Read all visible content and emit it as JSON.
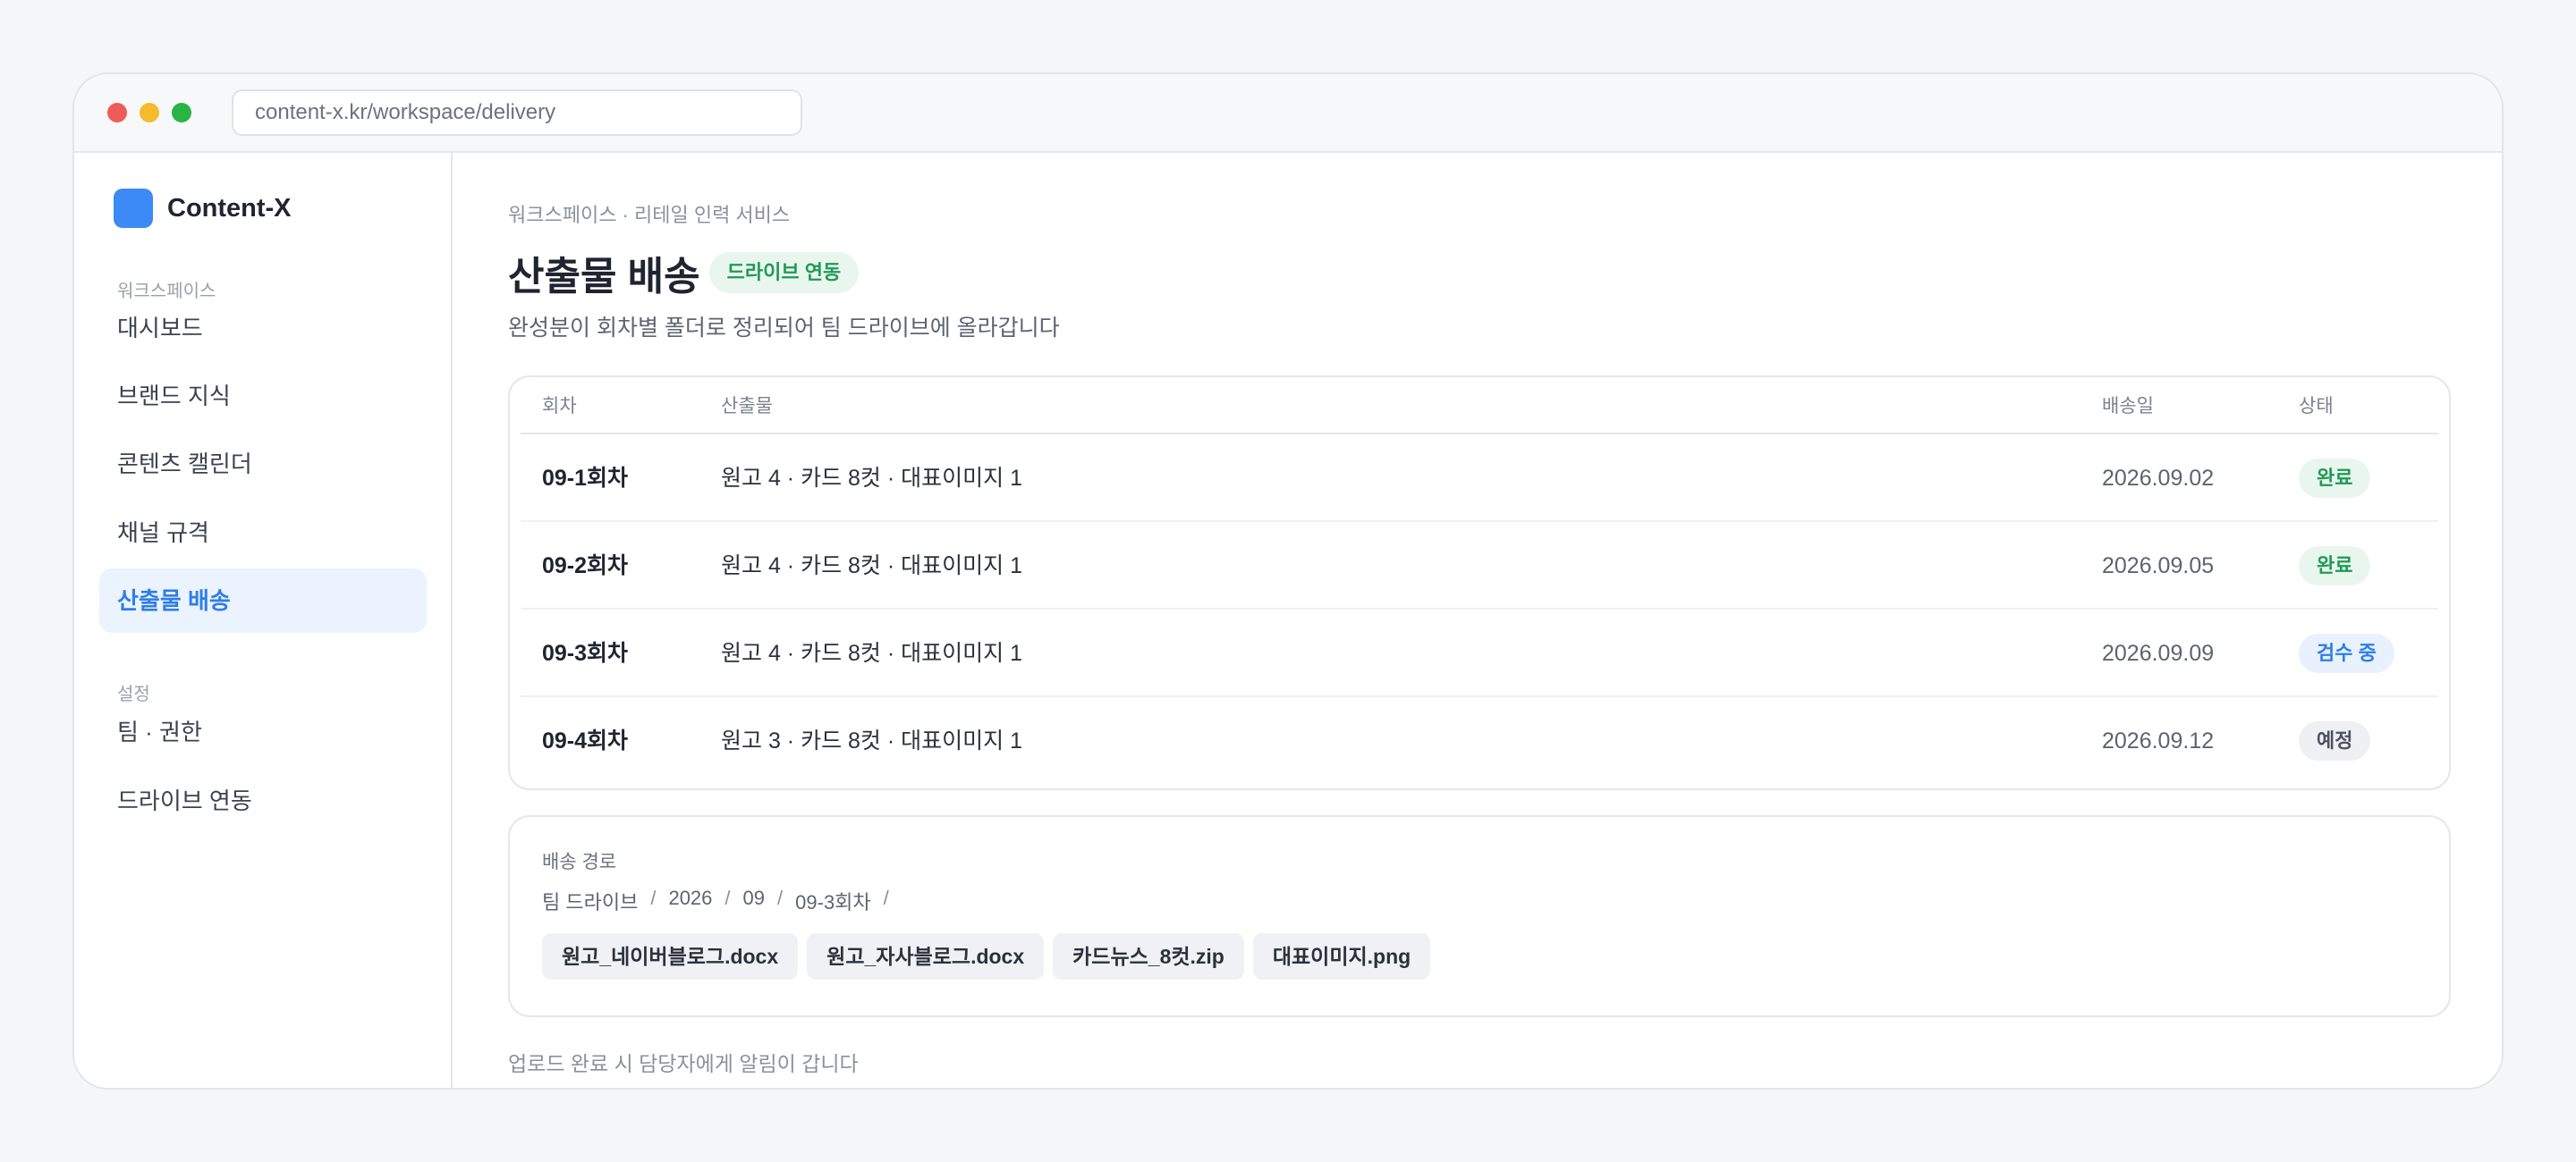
{
  "browser": {
    "url": "content-x.kr/workspace/delivery"
  },
  "sidebar": {
    "brand": "Content-X",
    "sections": [
      {
        "label": "워크스페이스",
        "items": [
          {
            "label": "대시보드",
            "active": false
          },
          {
            "label": "브랜드 지식",
            "active": false
          },
          {
            "label": "콘텐츠 캘린더",
            "active": false
          },
          {
            "label": "채널 규격",
            "active": false
          },
          {
            "label": "산출물 배송",
            "active": true
          }
        ]
      },
      {
        "label": "설정",
        "items": [
          {
            "label": "팀 · 권한",
            "active": false
          },
          {
            "label": "드라이브 연동",
            "active": false
          }
        ]
      }
    ]
  },
  "main": {
    "breadcrumb": "워크스페이스 · 리테일 인력 서비스",
    "title": "산출물 배송",
    "title_badge": "드라이브 연동",
    "subtitle": "완성분이 회차별 폴더로 정리되어 팀 드라이브에 올라갑니다",
    "table": {
      "headers": [
        "회차",
        "산출물",
        "배송일",
        "상태"
      ],
      "rows": [
        {
          "round": "09-1회차",
          "output": "원고 4 · 카드 8컷 · 대표이미지 1",
          "date": "2026.09.02",
          "status": "완료",
          "status_type": "done"
        },
        {
          "round": "09-2회차",
          "output": "원고 4 · 카드 8컷 · 대표이미지 1",
          "date": "2026.09.05",
          "status": "완료",
          "status_type": "done"
        },
        {
          "round": "09-3회차",
          "output": "원고 4 · 카드 8컷 · 대표이미지 1",
          "date": "2026.09.09",
          "status": "검수 중",
          "status_type": "review"
        },
        {
          "round": "09-4회차",
          "output": "원고 3 · 카드 8컷 · 대표이미지 1",
          "date": "2026.09.12",
          "status": "예정",
          "status_type": "planned"
        }
      ]
    },
    "delivery_path": {
      "label": "배송 경로",
      "segments": [
        "팀 드라이브",
        "2026",
        "09",
        "09-3회차"
      ],
      "files": [
        "원고_네이버블로그.docx",
        "원고_자사블로그.docx",
        "카드뉴스_8컷.zip",
        "대표이미지.png"
      ]
    },
    "footer_note": "업로드 완료 시 담당자에게 알림이 갑니다"
  },
  "colors": {
    "accent": "#3b8af5",
    "done": "#1f9a56",
    "review": "#2f7ee8",
    "planned": "#4b5260"
  }
}
